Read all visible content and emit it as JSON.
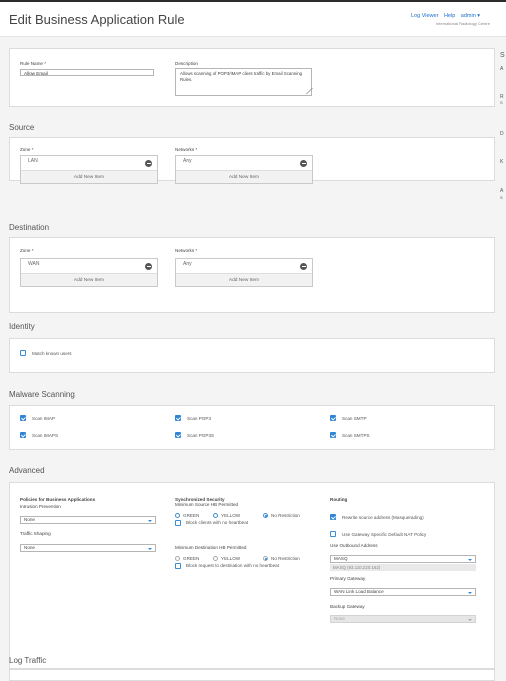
{
  "header": {
    "title": "Edit Business Application Rule",
    "links": [
      "Log Viewer",
      "Help",
      "admin ▾"
    ],
    "org": "International Radiology Centre"
  },
  "general": {
    "rule_name_label": "Rule Name *",
    "rule_name_value": "Allow Email",
    "description_label": "Description",
    "description_value": "Allows scanning of POP3/IMAP client traffic by Email Scanning Rules."
  },
  "source": {
    "section_title": "Source",
    "zone_label": "Zone *",
    "zone_value": "LAN",
    "networks_label": "Networks *",
    "networks_value": "Any",
    "add_new_item": "Add New Item"
  },
  "destination": {
    "section_title": "Destination",
    "zone_label": "Zone *",
    "zone_value": "WAN",
    "networks_label": "Networks *",
    "networks_value": "Any",
    "add_new_item": "Add New Item"
  },
  "identity": {
    "section_title": "Identity",
    "match_known_users": "Match known users"
  },
  "malware": {
    "section_title": "Malware Scanning",
    "items": [
      {
        "label": "Scan IMAP",
        "checked": true
      },
      {
        "label": "Scan POP3",
        "checked": true
      },
      {
        "label": "Scan SMTP",
        "checked": true
      },
      {
        "label": "Scan IMAPS",
        "checked": true
      },
      {
        "label": "Scan POP3S",
        "checked": true
      },
      {
        "label": "Scan SMTPS",
        "checked": true
      }
    ]
  },
  "advanced": {
    "section_title": "Advanced",
    "policies_title": "Policies for Business Applications",
    "intrusion_label": "Intrusion Prevention",
    "intrusion_value": "None",
    "shaping_label": "Traffic Shaping",
    "shaping_value": "None",
    "sync_title": "Synchronized Security",
    "min_source_hb_label": "Minimum Source HB Permitted",
    "min_dest_hb_label": "Minimum Destination HB Permitted",
    "hb_options": [
      "GREEN",
      "YELLOW",
      "No Restriction"
    ],
    "block_clients": "Block clients with no heartbeat",
    "block_dest": "Block request to destination with no heartbeat",
    "routing_title": "Routing",
    "rewrite_source": "Rewrite source address (Masquerading)",
    "use_gateway_nat": "Use Gateway Specific Default NAT Policy",
    "use_outbound_label": "Use Outbound Address",
    "outbound_value": "MASQ",
    "outbound_ip": "MASQ (93.110.220.162)",
    "primary_gateway_label": "Primary Gateway",
    "primary_gateway_value": "WAN Link Load Balance",
    "backup_gateway_label": "Backup Gateway",
    "backup_gateway_value": "None"
  },
  "log": {
    "section_title": "Log Traffic"
  },
  "right_panel": {
    "letters": [
      "S",
      "A",
      "R",
      "S",
      "D",
      "K",
      "A",
      "S"
    ]
  }
}
